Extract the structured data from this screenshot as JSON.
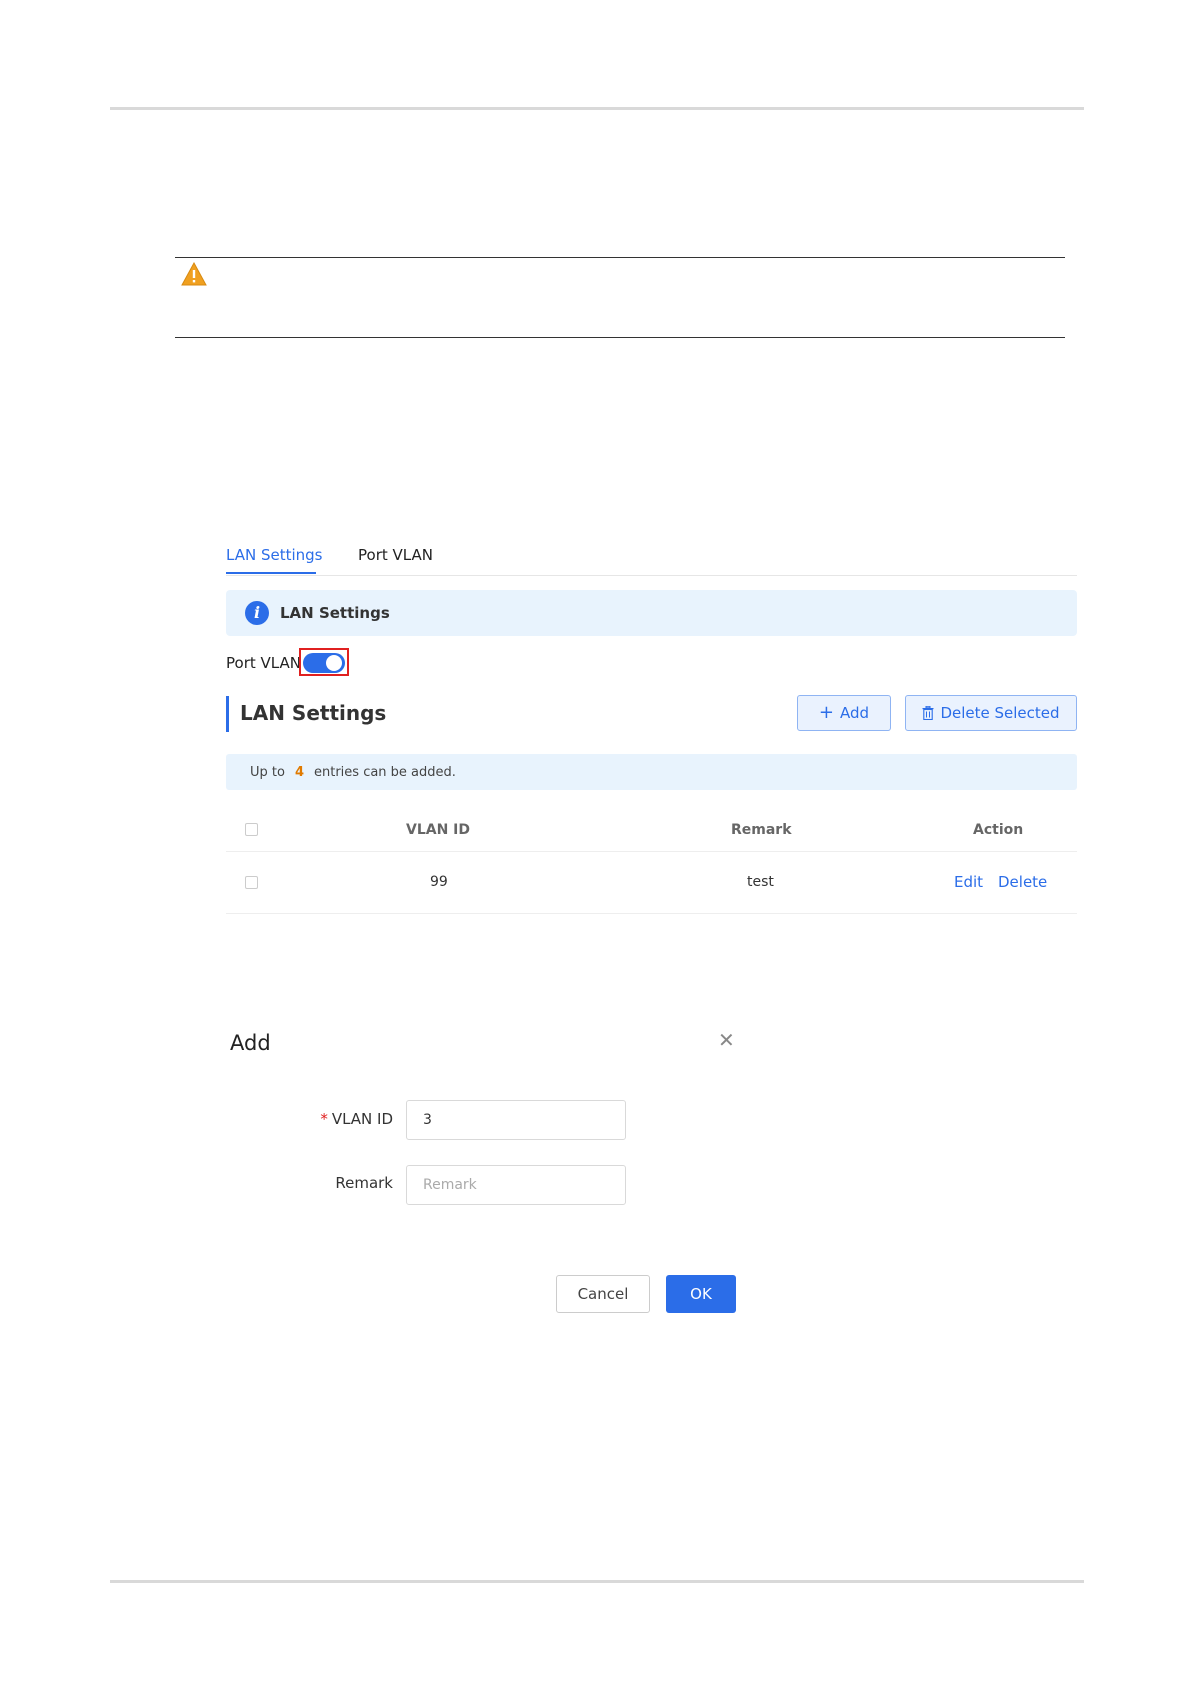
{
  "tabs": [
    {
      "label": "LAN Settings"
    },
    {
      "label": "Port VLAN"
    }
  ],
  "info_banner": {
    "text": "LAN Settings"
  },
  "port_vlan": {
    "label": "Port VLAN",
    "enabled": true
  },
  "section": {
    "title": "LAN Settings",
    "add_label": "Add",
    "delete_selected_label": "Delete Selected"
  },
  "limit": {
    "prefix": "Up to",
    "count": "4",
    "suffix": "entries can be added."
  },
  "table": {
    "headers": {
      "vlan_id": "VLAN ID",
      "remark": "Remark",
      "action": "Action"
    },
    "rows": [
      {
        "vlan_id": "99",
        "remark": "test",
        "edit": "Edit",
        "delete": "Delete"
      }
    ]
  },
  "dialog": {
    "title": "Add",
    "vlan_id_label": "VLAN ID",
    "vlan_id_value": "3",
    "remark_label": "Remark",
    "remark_placeholder": "Remark",
    "cancel_label": "Cancel",
    "ok_label": "OK"
  },
  "colors": {
    "accent": "#2b6de8",
    "warning": "#f0a020",
    "highlight": "#e02020"
  }
}
